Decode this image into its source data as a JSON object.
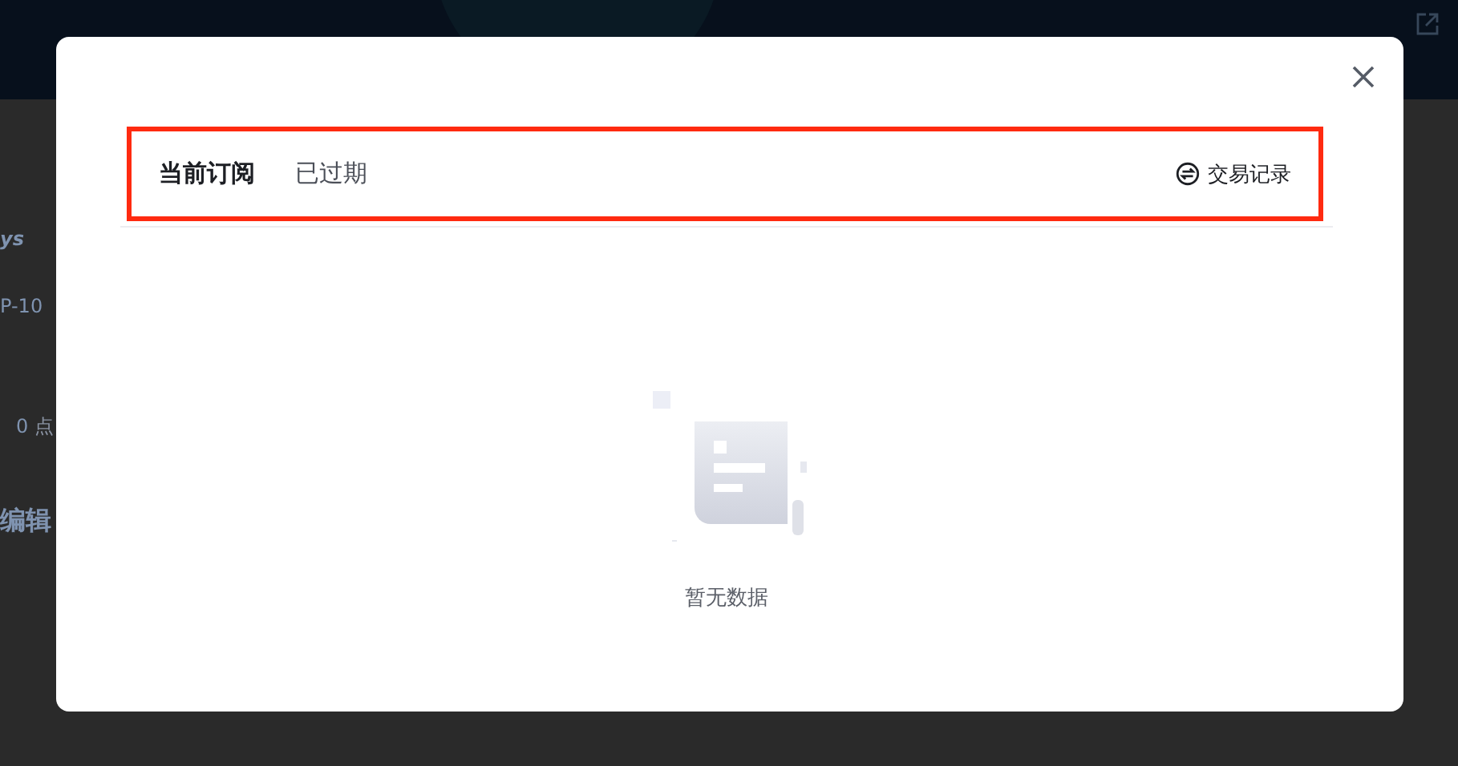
{
  "background": {
    "texts": [
      {
        "kind": "title",
        "text": "ys"
      },
      {
        "kind": "meta",
        "text": "P-10"
      },
      {
        "kind": "count",
        "text": "0",
        "unit": "点"
      },
      {
        "kind": "heading",
        "text": "编辑"
      }
    ]
  },
  "dialog": {
    "tabs": [
      {
        "label": "当前订阅",
        "selected": true
      },
      {
        "label": "已过期",
        "selected": false
      }
    ],
    "history_link": "交易记录",
    "empty_text": "暂无数据"
  }
}
